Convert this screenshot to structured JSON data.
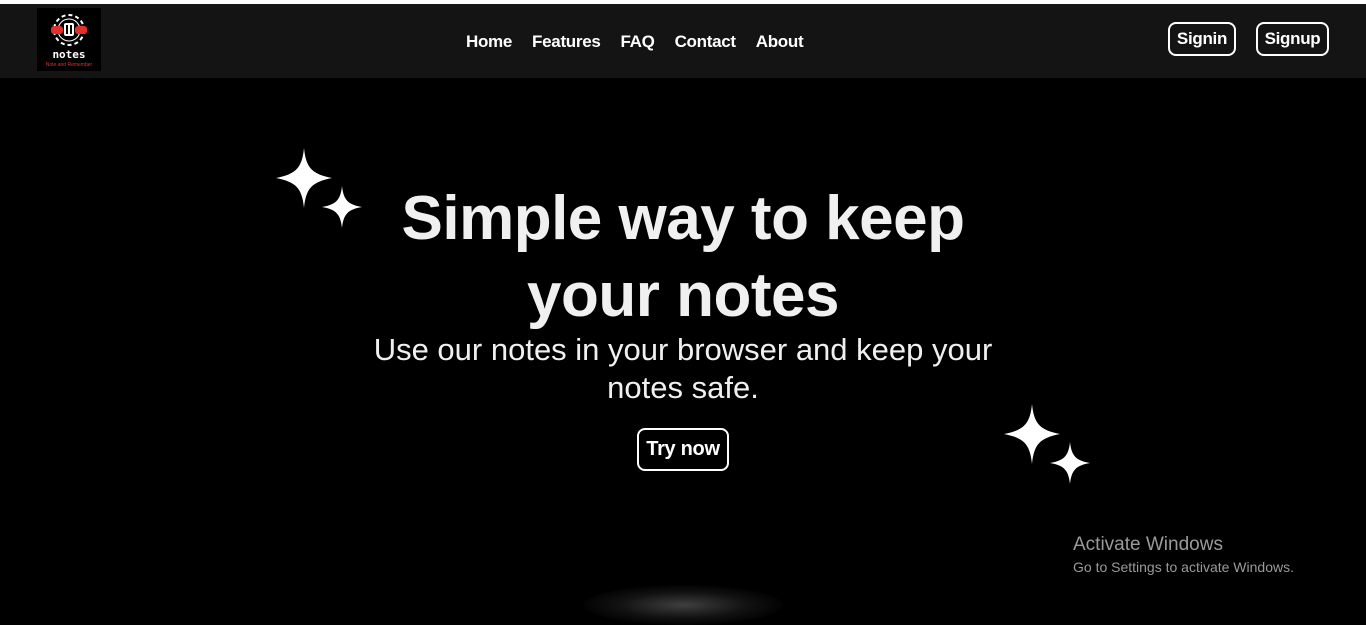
{
  "logo": {
    "word": "notes",
    "tagline": "Note and Remember"
  },
  "nav": {
    "links": [
      "Home",
      "Features",
      "FAQ",
      "Contact",
      "About"
    ]
  },
  "auth": {
    "signin": "Signin",
    "signup": "Signup"
  },
  "hero": {
    "title_line1": "Simple way to keep",
    "title_line2": "your notes",
    "subtitle_line1": "Use our notes in your browser and keep your",
    "subtitle_line2": "notes safe.",
    "cta": "Try now"
  },
  "watermark": {
    "title": "Activate Windows",
    "subtitle": "Go to Settings to activate Windows."
  },
  "colors": {
    "background": "#000000",
    "navbar": "#141414",
    "text": "#f0f0f0",
    "logo_accent": "#e0302a",
    "watermark": "#9a9a9a"
  }
}
